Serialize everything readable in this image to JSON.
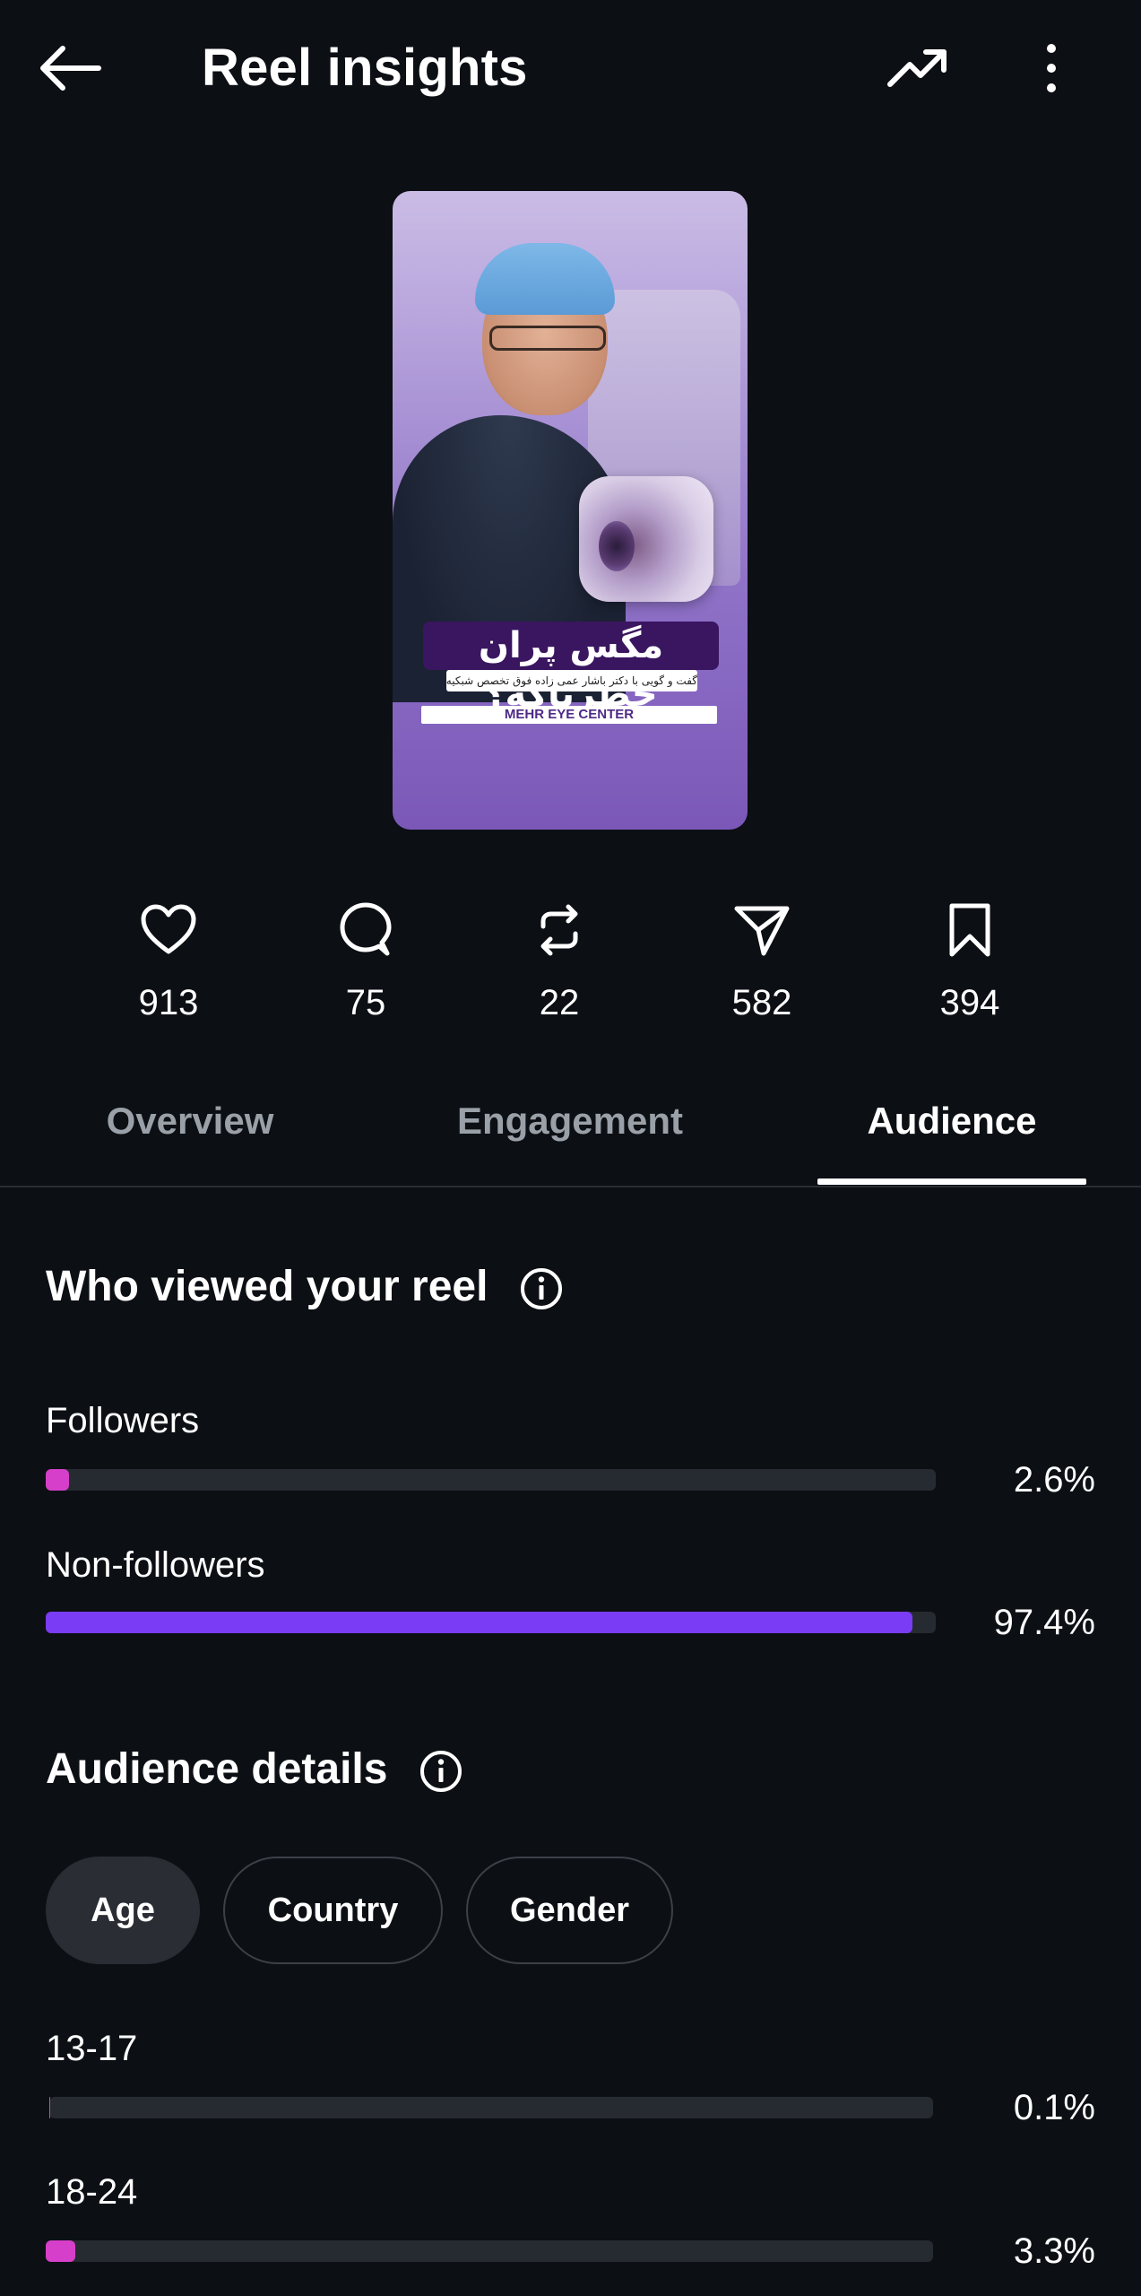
{
  "header": {
    "title": "Reel insights",
    "back_icon": "arrow-left-icon",
    "trend_icon": "trending-up-icon",
    "more_icon": "more-vertical-icon"
  },
  "thumbnail": {
    "headline": "مگس پران خطرناکه؟",
    "subline": "گفت و گویی با دکتر باشار عمی زاده فوق تخصص شبکیه",
    "brand": "MEHR EYE CENTER"
  },
  "stats": [
    {
      "icon": "heart-icon",
      "value": "913"
    },
    {
      "icon": "comment-icon",
      "value": "75"
    },
    {
      "icon": "repost-icon",
      "value": "22"
    },
    {
      "icon": "share-icon",
      "value": "582"
    },
    {
      "icon": "bookmark-icon",
      "value": "394"
    }
  ],
  "tabs": [
    {
      "label": "Overview",
      "active": false
    },
    {
      "label": "Engagement",
      "active": false
    },
    {
      "label": "Audience",
      "active": true
    }
  ],
  "viewers": {
    "title": "Who viewed your reel",
    "rows": [
      {
        "label": "Followers",
        "percent_text": "2.6%",
        "percent": 2.6,
        "color": "#d63fc9"
      },
      {
        "label": "Non-followers",
        "percent_text": "97.4%",
        "percent": 97.4,
        "color": "#7a3cf5"
      }
    ]
  },
  "audience": {
    "title": "Audience details",
    "chips": [
      {
        "label": "Age",
        "active": true
      },
      {
        "label": "Country",
        "active": false
      },
      {
        "label": "Gender",
        "active": false
      }
    ],
    "rows": [
      {
        "label": "13-17",
        "percent_text": "0.1%",
        "percent": 0.1,
        "color": "#d63fc9"
      },
      {
        "label": "18-24",
        "percent_text": "3.3%",
        "percent": 3.3,
        "color": "#d63fc9"
      }
    ]
  },
  "colors": {
    "background": "#0c0f14",
    "track": "#262a31",
    "followers": "#d63fc9",
    "non_followers": "#7a3cf5"
  }
}
